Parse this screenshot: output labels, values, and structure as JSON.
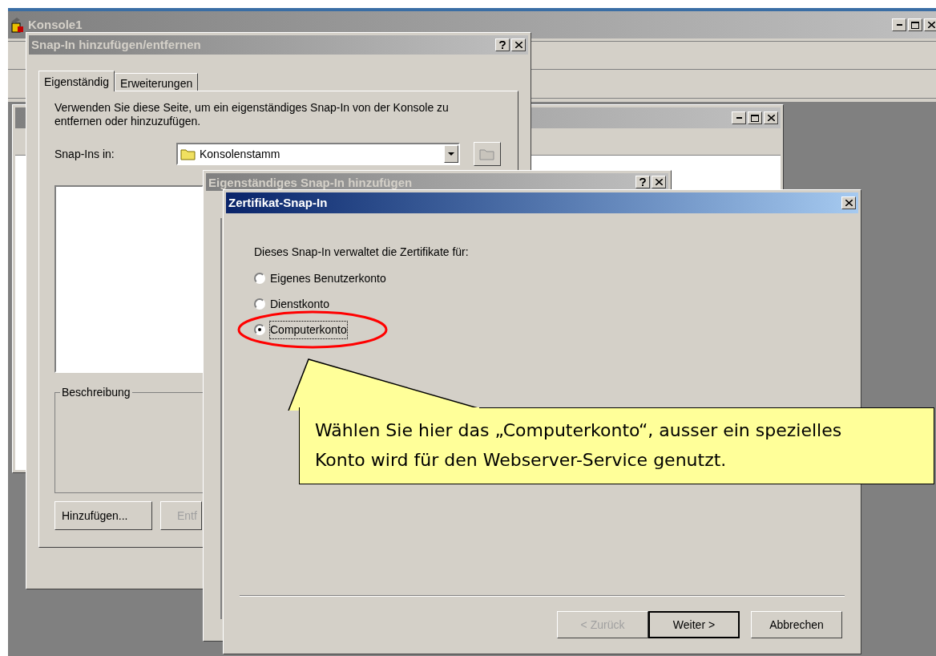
{
  "console_window": {
    "title": "Konsole1"
  },
  "snapin_dialog": {
    "title": "Snap-In hinzufügen/entfernen",
    "tabs": [
      {
        "label": "Eigenständig",
        "selected": true
      },
      {
        "label": "Erweiterungen",
        "selected": false
      }
    ],
    "description": "Verwenden Sie diese Seite, um ein eigenständiges Snap-In von der Konsole zu entfernen oder hinzuzufügen.",
    "location_label": "Snap-Ins in:",
    "location_value": "Konsolenstamm",
    "group_label": "Beschreibung",
    "buttons": [
      {
        "label": "Hinzufügen...",
        "disabled": false
      },
      {
        "label": "Entf",
        "disabled": true
      }
    ]
  },
  "add_dialog": {
    "title": "Eigenständiges Snap-In hinzufügen"
  },
  "cert_dialog": {
    "title": "Zertifikat-Snap-In",
    "prompt": "Dieses Snap-In verwaltet die Zertifikate für:",
    "options": [
      {
        "label": "Eigenes Benutzerkonto",
        "selected": false
      },
      {
        "label": "Dienstkonto",
        "selected": false
      },
      {
        "label": "Computerkonto",
        "selected": true
      }
    ],
    "buttons": [
      {
        "label": "< Zurück",
        "disabled": true,
        "default": false
      },
      {
        "label": "Weiter >",
        "disabled": false,
        "default": true
      },
      {
        "label": "Abbrechen",
        "disabled": false,
        "default": false
      }
    ]
  },
  "callout": {
    "text": "Wählen Sie hier das „Computerkonto“, ausser ein spezielles Konto wird für den Webserver-Service genutzt."
  }
}
